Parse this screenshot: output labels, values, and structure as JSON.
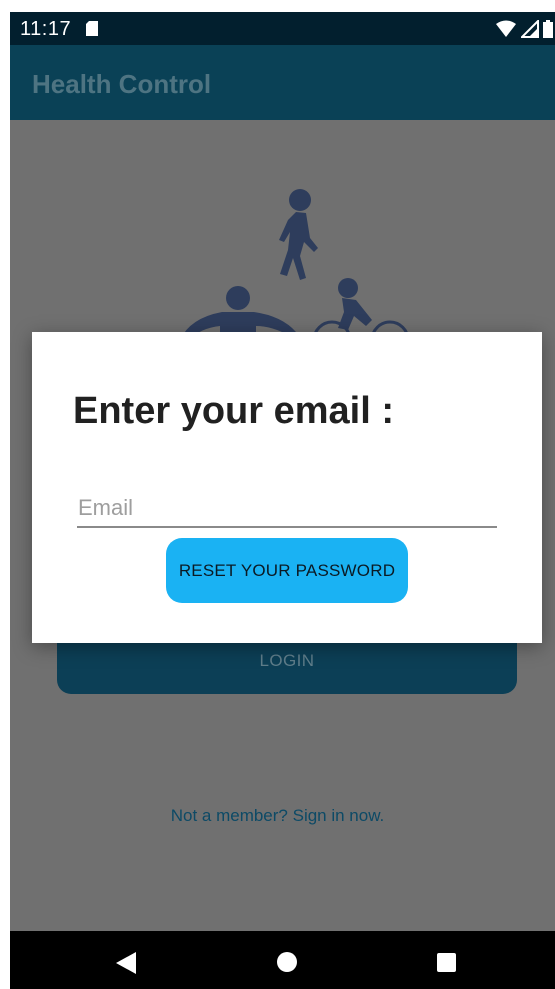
{
  "status_bar": {
    "time": "11:17",
    "icons": [
      "sd-card-icon",
      "wifi-icon",
      "signal-icon",
      "battery-icon"
    ]
  },
  "app_bar": {
    "title": "Health Control"
  },
  "background": {
    "login_label": "LOGIN",
    "signup_text": "Not a member? Sign in now."
  },
  "dialog": {
    "title": "Enter your email :",
    "email_placeholder": "Email",
    "email_value": "",
    "reset_label": "RESET YOUR PASSWORD"
  },
  "nav_bar": {
    "icons": [
      "back-icon",
      "home-icon",
      "recents-icon"
    ]
  },
  "colors": {
    "status_bar": "#021f2e",
    "app_bar": "#0a4156",
    "scrim_content": "#707070",
    "accent": "#1ab2f3",
    "login_button": "#0c3f56"
  }
}
